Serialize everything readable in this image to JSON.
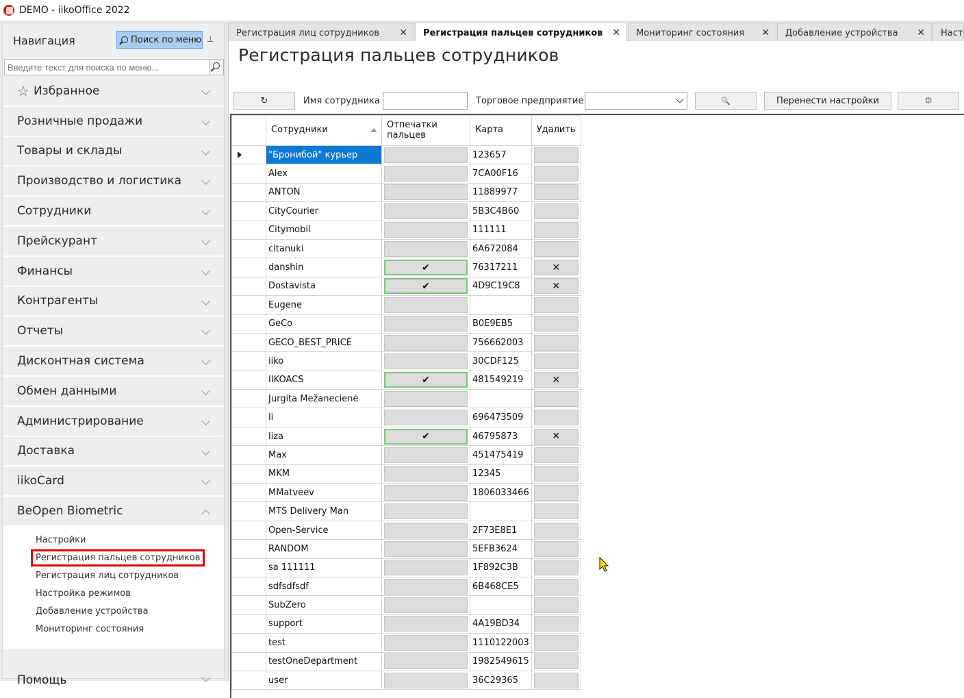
{
  "window": {
    "title": "DEMO - iikoOffice 2022"
  },
  "nav": {
    "title": "Навигация",
    "search_button": "Поиск по меню",
    "search_placeholder": "Введите текст для поиска по меню...",
    "items": [
      {
        "label": "Избранное",
        "icon": "star-icon"
      },
      {
        "label": "Розничные продажи"
      },
      {
        "label": "Товары и склады"
      },
      {
        "label": "Производство и логистика"
      },
      {
        "label": "Сотрудники"
      },
      {
        "label": "Прейскурант"
      },
      {
        "label": "Финансы"
      },
      {
        "label": "Контрагенты"
      },
      {
        "label": "Отчеты"
      },
      {
        "label": "Дисконтная система"
      },
      {
        "label": "Обмен данными"
      },
      {
        "label": "Администрирование"
      },
      {
        "label": "Доставка"
      },
      {
        "label": "iikoCard"
      },
      {
        "label": "BeOpen Biometric"
      }
    ],
    "sub_items": [
      "Настройки",
      "Регистрация пальцев сотрудников",
      "Регистрация лиц сотрудников",
      "Настройка режимов",
      "Добавление устройства",
      "Мониторинг состояния"
    ],
    "footer": "Помощь"
  },
  "tabs": [
    {
      "label": "Регистрация лиц сотрудников",
      "active": false
    },
    {
      "label": "Регистрация пальцев сотрудников",
      "active": true
    },
    {
      "label": "Мониторинг состояния",
      "active": false
    },
    {
      "label": "Добавление устройства",
      "active": false
    },
    {
      "label": "Настр",
      "active": false
    }
  ],
  "page": {
    "title": "Регистрация пальцев сотрудников",
    "refresh_glyph": "↻",
    "employee_name_label": "Имя сотрудника",
    "employee_name_value": "",
    "store_label": "Торговое предприятие",
    "store_value": "",
    "search_glyph": "🔍",
    "transfer_button": "Перенести настройки",
    "settings_glyph": "⚙"
  },
  "grid": {
    "columns": [
      "Сотрудники",
      "Отпечатки пальцев",
      "Карта",
      "Удалить"
    ],
    "rows": [
      {
        "name": "\"Бронибой\" курьер",
        "prints": false,
        "card": "123657",
        "del": false,
        "selected": true
      },
      {
        "name": "Alex",
        "prints": false,
        "card": "7CA00F16",
        "del": false
      },
      {
        "name": "ANTON",
        "prints": false,
        "card": "11889977",
        "del": false
      },
      {
        "name": "CityCourier",
        "prints": false,
        "card": "5B3C4B60",
        "del": false
      },
      {
        "name": "Citymobil",
        "prints": false,
        "card": "111111",
        "del": false
      },
      {
        "name": "cltanuki",
        "prints": false,
        "card": "6A672084",
        "del": false
      },
      {
        "name": "danshin",
        "prints": true,
        "card": "76317211",
        "del": true
      },
      {
        "name": "Dostavista",
        "prints": true,
        "card": "4D9C19C8",
        "del": true
      },
      {
        "name": "Eugene",
        "prints": false,
        "card": "",
        "del": false
      },
      {
        "name": "GeCo",
        "prints": false,
        "card": "B0E9EB5",
        "del": false
      },
      {
        "name": "GECO_BEST_PRICE",
        "prints": false,
        "card": "756662003",
        "del": false
      },
      {
        "name": "iiko",
        "prints": false,
        "card": "30CDF125",
        "del": false
      },
      {
        "name": "IIKOACS",
        "prints": true,
        "card": "481549219",
        "del": true
      },
      {
        "name": "Jurgita Mežanecienė",
        "prints": false,
        "card": "",
        "del": false
      },
      {
        "name": "li",
        "prints": false,
        "card": "696473509",
        "del": false
      },
      {
        "name": "liza",
        "prints": true,
        "card": "46795873",
        "del": true
      },
      {
        "name": "Max",
        "prints": false,
        "card": "451475419",
        "del": false
      },
      {
        "name": "MKM",
        "prints": false,
        "card": "12345",
        "del": false
      },
      {
        "name": "MMatveev",
        "prints": false,
        "card": "1806033466",
        "del": false
      },
      {
        "name": "MTS Delivery Man",
        "prints": false,
        "card": "",
        "del": false
      },
      {
        "name": "Open-Service",
        "prints": false,
        "card": "2F73E8E1",
        "del": false
      },
      {
        "name": "RANDOM",
        "prints": false,
        "card": "5EFB3624",
        "del": false
      },
      {
        "name": "sa 111111",
        "prints": false,
        "card": "1F892C3B",
        "del": false
      },
      {
        "name": "sdfsdfsdf",
        "prints": false,
        "card": "6B468CE5",
        "del": false
      },
      {
        "name": "SubZero",
        "prints": false,
        "card": "",
        "del": false
      },
      {
        "name": "support",
        "prints": false,
        "card": "4A19BD34",
        "del": false
      },
      {
        "name": "test",
        "prints": false,
        "card": "1110122003",
        "del": false
      },
      {
        "name": "testOneDepartment",
        "prints": false,
        "card": "1982549615",
        "del": false
      },
      {
        "name": "user",
        "prints": false,
        "card": "36C29365",
        "del": false
      }
    ],
    "check_glyph": "✔",
    "delete_glyph": "✕"
  },
  "colors": {
    "selection": "#0e78d5",
    "highlight_outline": "#e00000",
    "nav_search_button": "#a9cdf1"
  }
}
